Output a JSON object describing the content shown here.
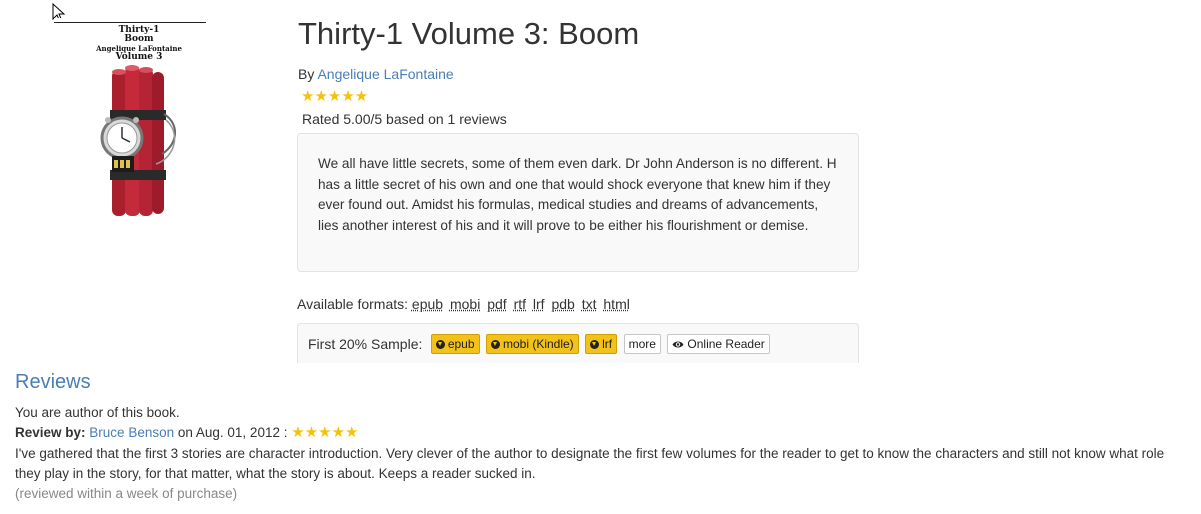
{
  "cover": {
    "title_lines": [
      "Thirty-1",
      "Boom",
      "Angelique LaFontaine",
      "Volume 3"
    ]
  },
  "book": {
    "title": "Thirty-1 Volume 3: Boom",
    "by_label": "By",
    "author": "Angelique LaFontaine",
    "rating_stars": "★★★★★",
    "rating_text": "Rated 5.00/5 based on 1 reviews",
    "description": "We all have little secrets, some of them even dark. Dr John Anderson is no different. H has a little secret of his own and one that would shock everyone that knew him if they ever found out. Amidst his formulas, medical studies and dreams of advancements, lies another interest of his and it will prove to be either his flourishment or demise."
  },
  "formats": {
    "label": "Available formats:",
    "items": [
      "epub",
      "mobi",
      "pdf",
      "rtf",
      "lrf",
      "pdb",
      "txt",
      "html"
    ]
  },
  "sample": {
    "label": "First 20% Sample:",
    "buttons": {
      "epub": "epub",
      "mobi": "mobi (Kindle)",
      "lrf": "lrf",
      "more": "more",
      "reader": "Online Reader"
    }
  },
  "reviews": {
    "heading": "Reviews",
    "author_note": "You are author of this book.",
    "items": [
      {
        "by_label": "Review by:",
        "reviewer": "Bruce Benson",
        "date_text": "on Aug. 01, 2012 :",
        "stars": "★★★★★",
        "body": "I've gathered that the first 3 stories are character introduction. Very clever of the author to designate the first few volumes for the reader to get to know the characters and still not know what role they play in the story, for that matter, what the story is about. Keeps a reader sucked in.",
        "note": "(reviewed within a week of purchase)"
      }
    ]
  },
  "colors": {
    "link": "#4a7eb5",
    "star": "#f4c20d",
    "warning_button": "#f2c21a"
  }
}
